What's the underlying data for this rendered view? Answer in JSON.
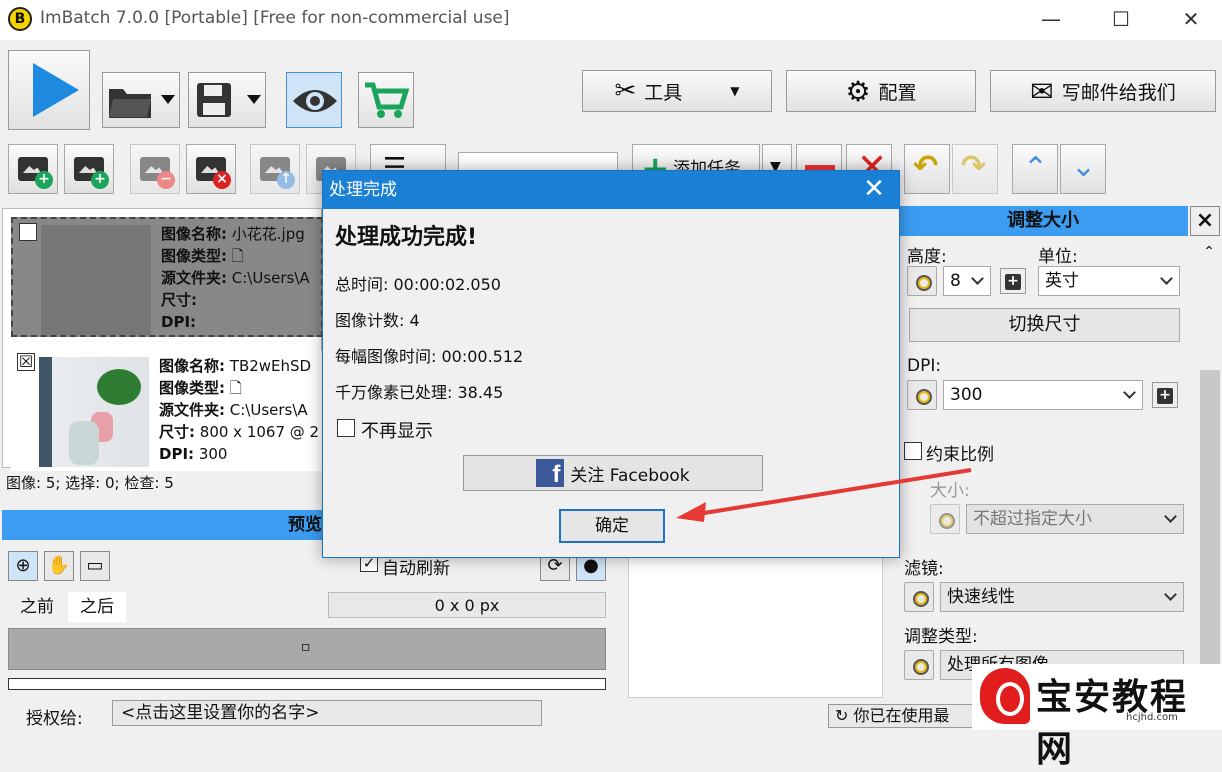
{
  "window": {
    "logo_letter": "B",
    "title": "ImBatch 7.0.0 [Portable] [Free for non-commercial use]",
    "minimize": "—",
    "maximize": "☐",
    "close": "✕"
  },
  "toolbar": {
    "tools_label": "工具",
    "config_label": "配置",
    "mail_label": "写邮件给我们",
    "add_task_label": "添加任务"
  },
  "image_list": {
    "items": [
      {
        "checked": "",
        "name_label": "图像名称:",
        "name_value": "小花花.jpg",
        "type_label": "图像类型:",
        "folder_label": "源文件夹:",
        "folder_value": "C:\\Users\\A",
        "size_label": "尺寸:",
        "size_value": "",
        "dpi_label": "DPI:",
        "dpi_value": ""
      },
      {
        "checked": "☒",
        "name_label": "图像名称:",
        "name_value": "TB2wEhSD",
        "type_label": "图像类型:",
        "folder_label": "源文件夹:",
        "folder_value": "C:\\Users\\A",
        "size_label": "尺寸:",
        "size_value": "800 x 1067 @ 2",
        "dpi_label": "DPI:",
        "dpi_value": "300"
      }
    ],
    "status": "图像: 5; 选择: 0; 检查: 5"
  },
  "preview": {
    "header": "预览",
    "auto_refresh": "自动刷新",
    "tab_before": "之前",
    "tab_after": "之后",
    "size_readout": "0 x 0 px",
    "dot": "▫"
  },
  "license": {
    "label": "授权给:",
    "field": "<点击这里设置你的名字>"
  },
  "resize_panel": {
    "header": "调整大小",
    "height_label": "高度:",
    "height_value": "8",
    "unit_label": "单位:",
    "unit_value": "英寸",
    "swap_label": "切换尺寸",
    "dpi_label": "DPI:",
    "dpi_value": "300",
    "keep_ratio_label": "约束比例",
    "size_label": "大小:",
    "size_value": "不超过指定大小",
    "filter_label": "滤镜:",
    "filter_value": "快速线性",
    "adjust_type_label": "调整类型:",
    "adjust_type_value": "处理所有图像"
  },
  "bottom_status": "你已在使用最",
  "dialog": {
    "title": "处理完成",
    "heading": "处理成功完成!",
    "total_time": "总时间: 00:00:02.050",
    "image_count": "图像计数: 4",
    "per_image_time": "每幅图像时间: 00:00.512",
    "megapixels": "千万像素已处理: 38.45",
    "dont_show": "不再显示",
    "facebook": "关注 Facebook",
    "ok": "确定"
  },
  "watermark": {
    "text": "宝安教程网",
    "sub": "hcjhd.com"
  }
}
